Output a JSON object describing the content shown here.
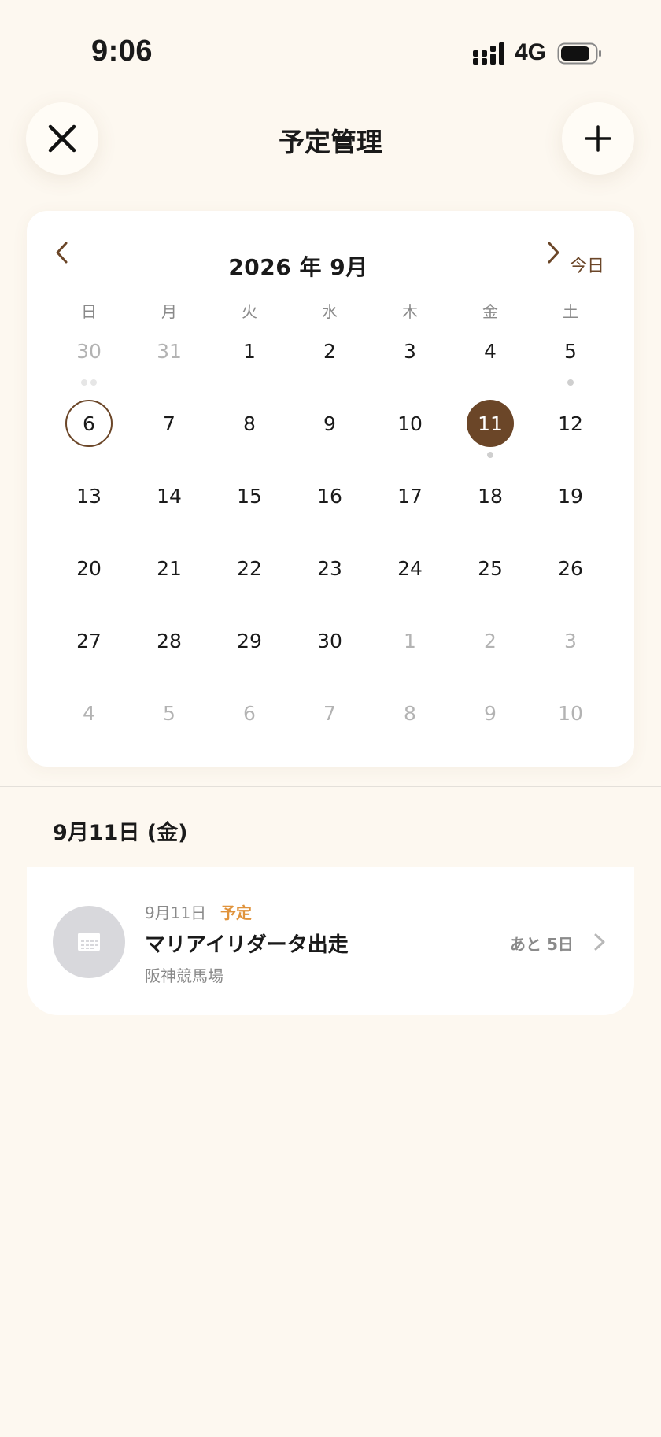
{
  "status_bar": {
    "time": "9:06",
    "network": "4G"
  },
  "nav": {
    "title": "予定管理",
    "close_icon": "close-icon",
    "add_icon": "plus-icon"
  },
  "calendar": {
    "month_title": "2026 年 9月",
    "today_label": "今日",
    "weekdays": [
      "日",
      "月",
      "火",
      "水",
      "木",
      "金",
      "土"
    ],
    "days": [
      {
        "d": "30",
        "muted": true,
        "dots": 2
      },
      {
        "d": "31",
        "muted": true
      },
      {
        "d": "1"
      },
      {
        "d": "2"
      },
      {
        "d": "3"
      },
      {
        "d": "4"
      },
      {
        "d": "5",
        "dots": 1
      },
      {
        "d": "6",
        "today": true
      },
      {
        "d": "7"
      },
      {
        "d": "8"
      },
      {
        "d": "9"
      },
      {
        "d": "10"
      },
      {
        "d": "11",
        "selected": true,
        "dots": 1
      },
      {
        "d": "12"
      },
      {
        "d": "13"
      },
      {
        "d": "14"
      },
      {
        "d": "15"
      },
      {
        "d": "16"
      },
      {
        "d": "17"
      },
      {
        "d": "18"
      },
      {
        "d": "19"
      },
      {
        "d": "20"
      },
      {
        "d": "21"
      },
      {
        "d": "22"
      },
      {
        "d": "23"
      },
      {
        "d": "24"
      },
      {
        "d": "25"
      },
      {
        "d": "26"
      },
      {
        "d": "27"
      },
      {
        "d": "28"
      },
      {
        "d": "29"
      },
      {
        "d": "30"
      },
      {
        "d": "1",
        "muted": true
      },
      {
        "d": "2",
        "muted": true
      },
      {
        "d": "3",
        "muted": true
      },
      {
        "d": "4",
        "muted": true
      },
      {
        "d": "5",
        "muted": true
      },
      {
        "d": "6",
        "muted": true
      },
      {
        "d": "7",
        "muted": true
      },
      {
        "d": "8",
        "muted": true
      },
      {
        "d": "9",
        "muted": true
      },
      {
        "d": "10",
        "muted": true
      }
    ]
  },
  "selected_date_heading": "9月11日 (金)",
  "event": {
    "date": "9月11日",
    "status": "予定",
    "title": "マリアイリダータ出走",
    "venue": "阪神競馬場",
    "countdown": "あと 5日",
    "icon": "calendar-icon"
  },
  "colors": {
    "background": "#fdf8f0",
    "accent_brown": "#6b4628",
    "status_orange": "#e0933c"
  }
}
